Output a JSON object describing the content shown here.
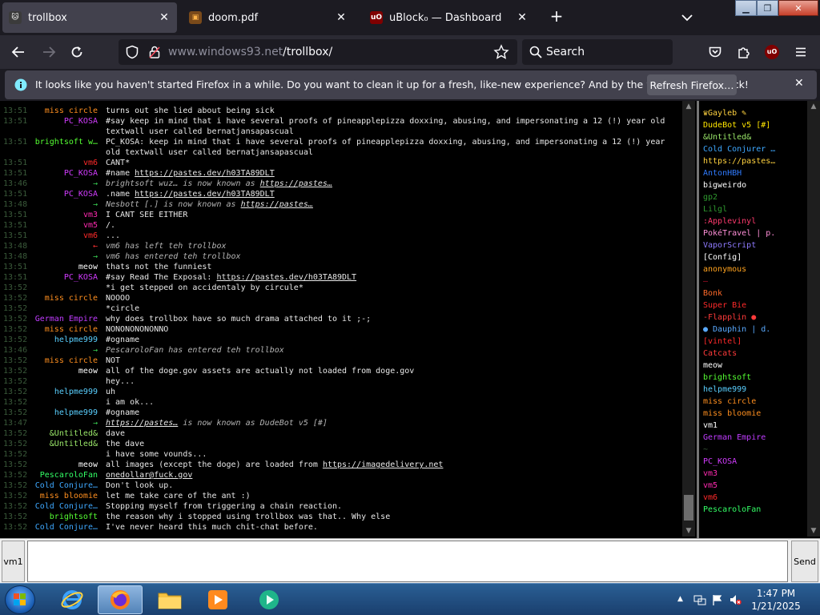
{
  "browser": {
    "tabs": [
      {
        "title": "trollbox",
        "active": true
      },
      {
        "title": "doom.pdf",
        "active": false
      },
      {
        "title": "uBlock₀ — Dashboard",
        "active": false
      }
    ],
    "url_domain": "www.windows93.net",
    "url_path": "/trollbox/",
    "search_placeholder": "Search"
  },
  "notification": {
    "message": "It looks like you haven't started Firefox in a while. Do you want to clean it up for a fresh, like-new experience? And by the way, welcome back!",
    "button": "Refresh Firefox…"
  },
  "chat": {
    "messages": [
      {
        "time": "13:51",
        "nick": "miss circle",
        "color": "#ff8f1f",
        "text": "turns out she lied about being sick"
      },
      {
        "time": "13:51",
        "nick": "PC_KOSA",
        "color": "#d23cff",
        "text": "#say keep in mind that i have several proofs of pineapplepizza doxxing, abusing, and impersonating a 12 (!) year old"
      },
      {
        "time": "",
        "nick": "",
        "color": "#ffffff",
        "text": "textwall user called bernatjansapascual"
      },
      {
        "time": "13:51",
        "nick": "brightsoft w…",
        "color": "#55ff33",
        "text": "PC_KOSA: keep in mind that i have several proofs of pineapplepizza doxxing, abusing, and impersonating a 12 (!) year"
      },
      {
        "time": "",
        "nick": "",
        "color": "#ffffff",
        "text": "old textwall user called bernatjansapascual"
      },
      {
        "time": "13:51",
        "nick": "vm6",
        "color": "#ff2a2a",
        "text": "CANT*"
      },
      {
        "time": "13:51",
        "nick": "PC_KOSA",
        "color": "#d23cff",
        "text": "#name https://pastes.dev/h03TA89DLT"
      },
      {
        "time": "13:46",
        "nick": "→",
        "color": "#39d353",
        "text": "brightsoft wuz… is now known as https://pastes…",
        "system": true
      },
      {
        "time": "13:51",
        "nick": "PC_KOSA",
        "color": "#d23cff",
        "text": ".name https://pastes.dev/h03TA89DLT"
      },
      {
        "time": "13:48",
        "nick": "→",
        "color": "#39d353",
        "text": "Nesbott [.] is now known as https://pastes…",
        "system": true
      },
      {
        "time": "13:51",
        "nick": "vm3",
        "color": "#ff2ab0",
        "text": "I CANT SEE EITHER"
      },
      {
        "time": "13:51",
        "nick": "vm5",
        "color": "#ff2ab0",
        "text": "/."
      },
      {
        "time": "13:51",
        "nick": "vm6",
        "color": "#ff2a2a",
        "text": "..."
      },
      {
        "time": "13:48",
        "nick": "←",
        "color": "#ff3333",
        "text": "vm6 has left teh trollbox",
        "system": true
      },
      {
        "time": "13:48",
        "nick": "→",
        "color": "#39d353",
        "text": "vm6 has entered teh trollbox",
        "system": true
      },
      {
        "time": "13:51",
        "nick": "meow",
        "color": "#ffffff",
        "text": "thats not the funniest"
      },
      {
        "time": "13:51",
        "nick": "PC_KOSA",
        "color": "#d23cff",
        "text": "#say Read The Exposal: https://pastes.dev/h03TA89DLT"
      },
      {
        "time": "13:52",
        "nick": "",
        "color": "#ffffff",
        "text": "*i get stepped on accidentaly by circule*"
      },
      {
        "time": "13:52",
        "nick": "miss circle",
        "color": "#ff8f1f",
        "text": "NOOOO"
      },
      {
        "time": "13:52",
        "nick": "",
        "color": "#ffffff",
        "text": "*circle"
      },
      {
        "time": "13:52",
        "nick": "German Empire",
        "color": "#c03cff",
        "text": "why does trollbox have so much drama attached to it ;-;"
      },
      {
        "time": "13:52",
        "nick": "miss circle",
        "color": "#ff8f1f",
        "text": "NONONONONONNO"
      },
      {
        "time": "13:52",
        "nick": "helpme999",
        "color": "#5ad0ff",
        "text": "#ogname"
      },
      {
        "time": "13:46",
        "nick": "→",
        "color": "#39d353",
        "text": "PescaroloFan has entered teh trollbox",
        "system": true
      },
      {
        "time": "13:52",
        "nick": "miss circle",
        "color": "#ff8f1f",
        "text": "NOT"
      },
      {
        "time": "13:52",
        "nick": "meow",
        "color": "#ffffff",
        "text": "all of the doge.gov assets are actually not loaded from doge.gov"
      },
      {
        "time": "13:52",
        "nick": "",
        "color": "#ffffff",
        "text": "hey..."
      },
      {
        "time": "13:52",
        "nick": "helpme999",
        "color": "#5ad0ff",
        "text": "uh"
      },
      {
        "time": "13:52",
        "nick": "",
        "color": "#ffffff",
        "text": "i am ok..."
      },
      {
        "time": "13:52",
        "nick": "helpme999",
        "color": "#5ad0ff",
        "text": "#ogname"
      },
      {
        "time": "13:47",
        "nick": "→",
        "color": "#39d353",
        "text": "https://pastes… is now known as DudeBot v5 [#]",
        "system": true
      },
      {
        "time": "13:52",
        "nick": "&Untitled&",
        "color": "#9be86a",
        "text": "dave"
      },
      {
        "time": "13:52",
        "nick": "&Untitled&",
        "color": "#9be86a",
        "text": "the dave"
      },
      {
        "time": "13:52",
        "nick": "",
        "color": "#ffffff",
        "text": "i have some vounds..."
      },
      {
        "time": "13:52",
        "nick": "meow",
        "color": "#ffffff",
        "text": "all images (except the doge) are loaded from https://imagedelivery.net"
      },
      {
        "time": "13:52",
        "nick": "PescaroloFan",
        "color": "#33ff66",
        "text": "onedollar@fuck.gov"
      },
      {
        "time": "13:52",
        "nick": "Cold Conjure…",
        "color": "#3ea8ff",
        "text": "Don't look up."
      },
      {
        "time": "13:52",
        "nick": "miss bloomie",
        "color": "#ff8f1f",
        "text": "let me take care of the ant :)"
      },
      {
        "time": "13:52",
        "nick": "Cold Conjure…",
        "color": "#3ea8ff",
        "text": "Stopping myself from triggering a chain reaction."
      },
      {
        "time": "13:52",
        "nick": "brightsoft",
        "color": "#55ff33",
        "text": "the reason why i stopped using trollbox was that.. Why else"
      },
      {
        "time": "13:52",
        "nick": "Cold Conjure…",
        "color": "#3ea8ff",
        "text": "I've never heard this much chit-chat before."
      }
    ]
  },
  "users": [
    {
      "name": "♛Gayleb ✎",
      "color": "#ffd23f"
    },
    {
      "name": "DudeBot v5 [#]",
      "color": "#ffe600"
    },
    {
      "name": "&Untitled&",
      "color": "#9be86a"
    },
    {
      "name": "Cold Conjurer …",
      "color": "#3ea8ff"
    },
    {
      "name": "https://pastes…",
      "color": "#ffd23f"
    },
    {
      "name": "AntonHBH",
      "color": "#2f7bff"
    },
    {
      "name": "bigweirdo",
      "color": "#ffffff"
    },
    {
      "name": "gp2",
      "color": "#2f9a2f"
    },
    {
      "name": "Lilgl",
      "color": "#2f9a2f"
    },
    {
      "name": ":Applevinyl",
      "color": "#ff3a6e"
    },
    {
      "name": "PokéTravel | p.",
      "color": "#ff8fd8"
    },
    {
      "name": "VaporScript",
      "color": "#8f7bff"
    },
    {
      "name": "[Config]",
      "color": "#ffffff"
    },
    {
      "name": "anonymous",
      "color": "#ffa31f"
    },
    {
      "name": "—",
      "color": "#b3122b"
    },
    {
      "name": "Bonk",
      "color": "#ff6a2a"
    },
    {
      "name": "Super Bie",
      "color": "#ff2a2a"
    },
    {
      "name": "-Flapplin ●",
      "color": "#ff3a3a"
    },
    {
      "name": "● Dauphin | d.",
      "color": "#5aaaff"
    },
    {
      "name": "[vintel]",
      "color": "#ff2a2a"
    },
    {
      "name": "Catcats",
      "color": "#ff3a3a"
    },
    {
      "name": "meow",
      "color": "#ffffff"
    },
    {
      "name": "brightsoft",
      "color": "#55ff33"
    },
    {
      "name": "helpme999",
      "color": "#5ad0ff"
    },
    {
      "name": "miss circle",
      "color": "#ff8f1f"
    },
    {
      "name": "miss bloomie",
      "color": "#ff8f1f"
    },
    {
      "name": "vm1",
      "color": "#ffffff"
    },
    {
      "name": "German Empire",
      "color": "#c03cff"
    },
    {
      "name": "~",
      "color": "#3a5a3a"
    },
    {
      "name": "PC_KOSA",
      "color": "#d23cff"
    },
    {
      "name": "vm3",
      "color": "#ff2ab0"
    },
    {
      "name": "vm5",
      "color": "#ff2ab0"
    },
    {
      "name": "vm6",
      "color": "#ff2a2a"
    },
    {
      "name": "PescaroloFan",
      "color": "#33ff66"
    }
  ],
  "input": {
    "nick": "vm1",
    "value": "",
    "send": "Send"
  },
  "taskbar": {
    "time": "1:47 PM",
    "date": "1/21/2025"
  }
}
